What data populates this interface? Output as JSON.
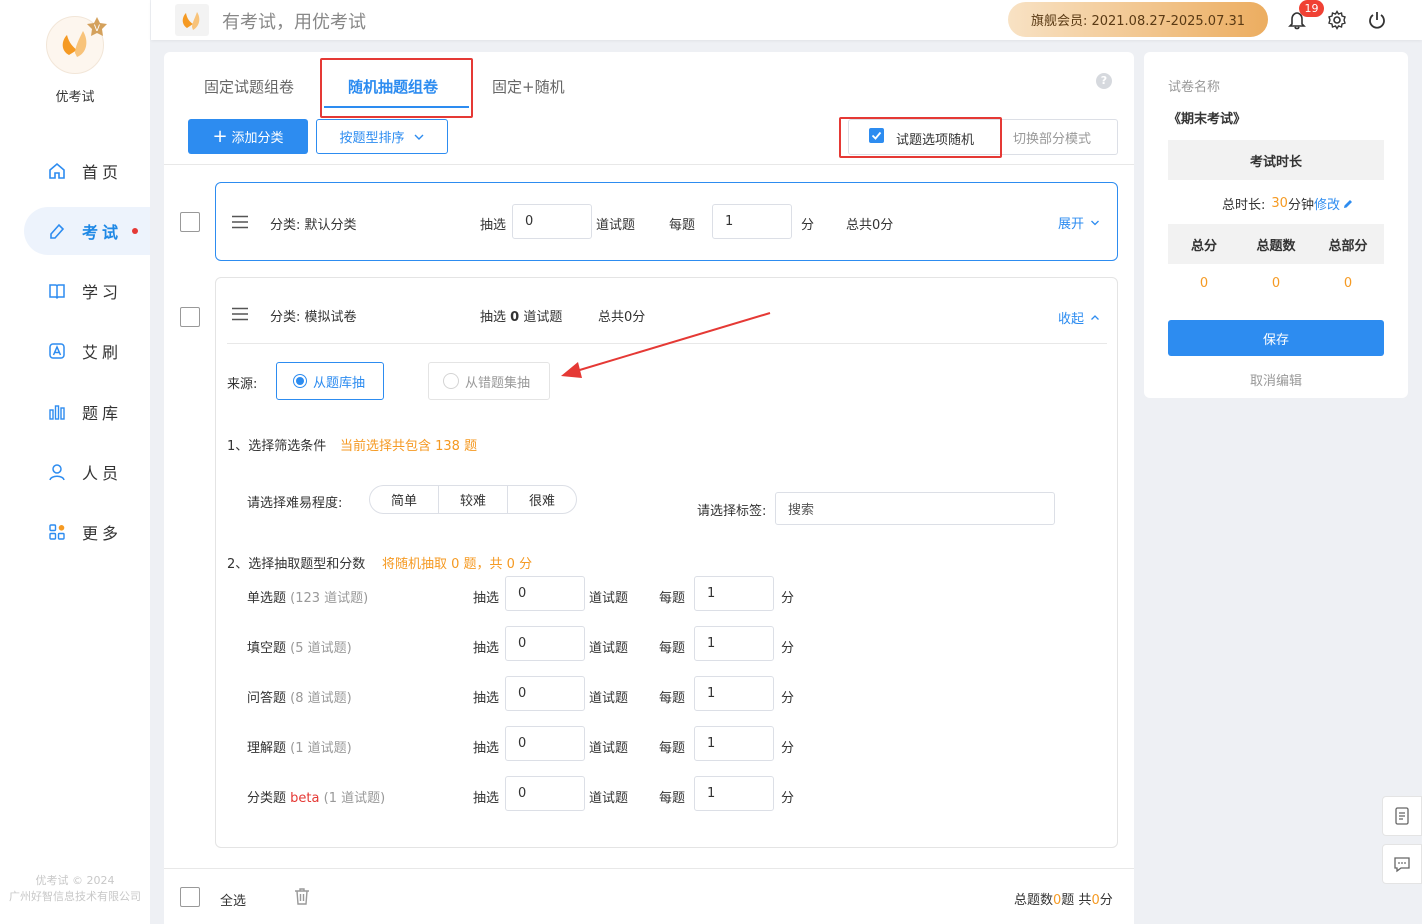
{
  "app": {
    "name": "优考试",
    "slogan": "有考试，用优考试",
    "copyright": "优考试 © 2024",
    "company": "广州好智信息技术有限公司"
  },
  "header": {
    "membership": "旗舰会员: 2021.08.27-2025.07.31",
    "notification_count": "19"
  },
  "sidebar": {
    "items": [
      {
        "label": "首页",
        "icon": "home-icon",
        "active": false
      },
      {
        "label": "考试",
        "icon": "exam-icon",
        "active": true
      },
      {
        "label": "学习",
        "icon": "book-icon",
        "active": false
      },
      {
        "label": "艾刷",
        "icon": "a-icon",
        "active": false
      },
      {
        "label": "题库",
        "icon": "bank-icon",
        "active": false
      },
      {
        "label": "人员",
        "icon": "user-icon",
        "active": false
      },
      {
        "label": "更多",
        "icon": "more-icon",
        "active": false
      }
    ]
  },
  "tabs": [
    "固定试题组卷",
    "随机抽题组卷",
    "固定+随机"
  ],
  "toolbar": {
    "add_category": "添加分类",
    "sort_by_type": "按题型排序",
    "randomize_options": "试题选项随机",
    "switch_mode": "切换部分模式"
  },
  "category1": {
    "name": "分类: 默认分类",
    "pick_label": "抽选",
    "pick_value": "0",
    "unit_questions": "道试题",
    "each_label": "每题",
    "each_value": "1",
    "unit_score": "分",
    "total": "总共0分",
    "expand": "展开"
  },
  "category2": {
    "name": "分类: 模拟试卷",
    "pick_prefix": "抽选",
    "pick_count": "0",
    "pick_suffix": "道试题",
    "total": "总共0分",
    "collapse": "收起",
    "source_label": "来源:",
    "source_bank": "从题库抽",
    "source_wrong": "从错题集抽",
    "step1_title": "1、选择筛选条件",
    "step1_note": "当前选择共包含 138 题",
    "difficulty_label": "请选择难易程度:",
    "difficulty_options": [
      "简单",
      "较难",
      "很难"
    ],
    "tag_label": "请选择标签:",
    "tag_placeholder": "搜索",
    "step2_title": "2、选择抽取题型和分数",
    "step2_note": "将随机抽取 0 题，共 0 分",
    "question_types": [
      {
        "name": "单选题",
        "beta": "",
        "count": "(123 道试题)",
        "pick": "0",
        "score": "1"
      },
      {
        "name": "填空题",
        "beta": "",
        "count": "(5 道试题)",
        "pick": "0",
        "score": "1"
      },
      {
        "name": "问答题",
        "beta": "",
        "count": "(8 道试题)",
        "pick": "0",
        "score": "1"
      },
      {
        "name": "理解题",
        "beta": "",
        "count": "(1 道试题)",
        "pick": "0",
        "score": "1"
      },
      {
        "name": "分类题",
        "beta": "beta",
        "count": "(1 道试题)",
        "pick": "0",
        "score": "1"
      }
    ],
    "row_pick_label": "抽选",
    "row_unit": "道试题",
    "row_each": "每题",
    "row_score_unit": "分"
  },
  "bottom": {
    "select_all": "全选",
    "summary_prefix": "总题数",
    "summary_count": "0",
    "summary_mid": "题 共",
    "summary_score": "0",
    "summary_suffix": "分"
  },
  "right_panel": {
    "paper_name_label": "试卷名称",
    "paper_name": "《期末考试》",
    "duration_header": "考试时长",
    "duration_label": "总时长:",
    "duration_value": "30",
    "duration_unit": "分钟",
    "modify": "修改",
    "stats_headers": [
      "总分",
      "总题数",
      "总部分"
    ],
    "stats_values": [
      "0",
      "0",
      "0"
    ],
    "save": "保存",
    "cancel": "取消编辑"
  },
  "colors": {
    "primary": "#2d8cf0",
    "accent_orange": "#f59a23",
    "highlight_red": "#e53935"
  }
}
